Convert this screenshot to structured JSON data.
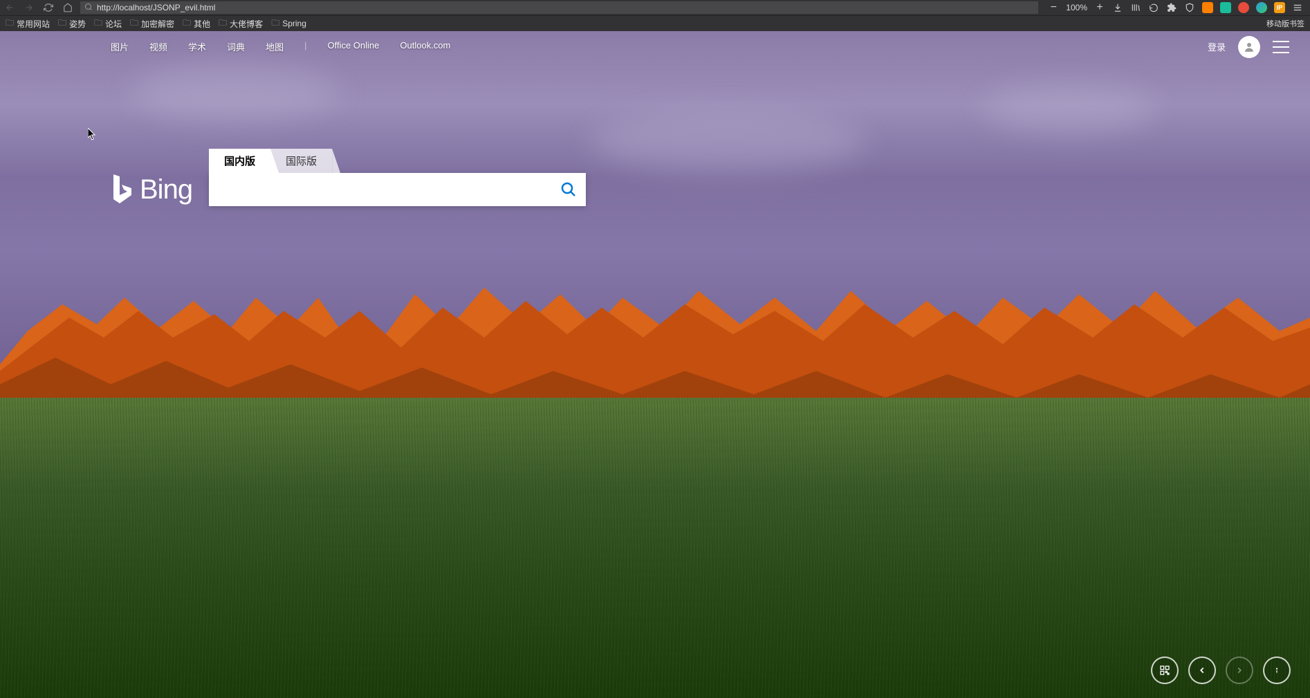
{
  "browser": {
    "url_display": "http://localhost/JSONP_evil.html",
    "url_host": "localhost",
    "zoom": "100%",
    "bookmarks": [
      "常用网站",
      "姿势",
      "论坛",
      "加密解密",
      "其他",
      "大佬博客",
      "Spring"
    ],
    "mobile_bookmarks_label": "移动版书签"
  },
  "nav": {
    "links": [
      "图片",
      "视频",
      "学术",
      "词典",
      "地图"
    ],
    "extra_links": [
      "Office Online",
      "Outlook.com"
    ],
    "login": "登录"
  },
  "logo": {
    "text": "Bing"
  },
  "search": {
    "tabs": [
      {
        "label": "国内版",
        "active": true
      },
      {
        "label": "国际版",
        "active": false
      }
    ],
    "value": "",
    "placeholder": ""
  },
  "ext_colors": [
    "#ff7f00",
    "#1abc9c",
    "#e74c3c",
    "#3498db",
    "#f39c12"
  ]
}
